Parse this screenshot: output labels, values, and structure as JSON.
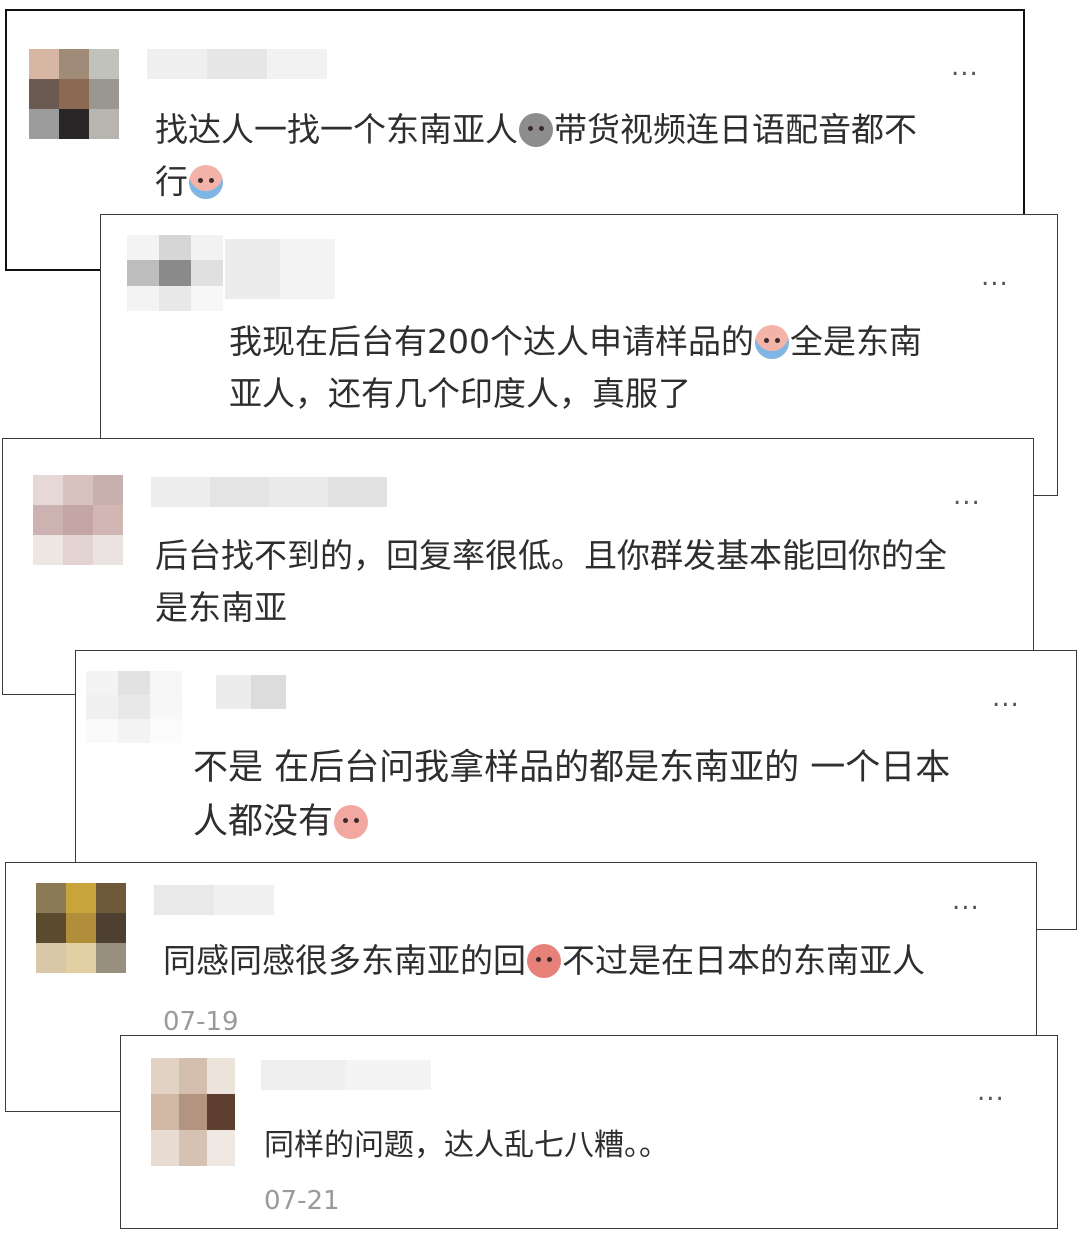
{
  "comments": [
    {
      "id": "c1",
      "more": "...",
      "text1": "找达人一找一个东南亚人",
      "emoji1": "dust-face-emoji",
      "text2": "带货视频连日语配音都不",
      "text3": "行",
      "emoji2": "crying-emoji"
    },
    {
      "id": "c2",
      "more": "...",
      "text1": "我现在后台有200个达人申请样品的",
      "emoji1": "crying-emoji",
      "text2": "全是东南",
      "text3": "亚人，还有几个印度人，真服了"
    },
    {
      "id": "c3",
      "more": "...",
      "text1": "后台找不到的，回复率很低。且你群发基本能回你的全",
      "text2": "是东南亚"
    },
    {
      "id": "c4",
      "more": "...",
      "text1": "不是 在后台问我拿样品的都是东南亚的 一个日本",
      "text2": "人都没有",
      "emoji1": "smile-emoji"
    },
    {
      "id": "c5",
      "more": "...",
      "text1": "同感同感很多东南亚的回",
      "emoji1": "angry-emoji",
      "text2": "不过是在日本的东南亚人",
      "date": "07-19"
    },
    {
      "id": "c6",
      "more": "...",
      "text1": "同样的问题，达人乱七八糟。。",
      "date": "07-21"
    }
  ]
}
